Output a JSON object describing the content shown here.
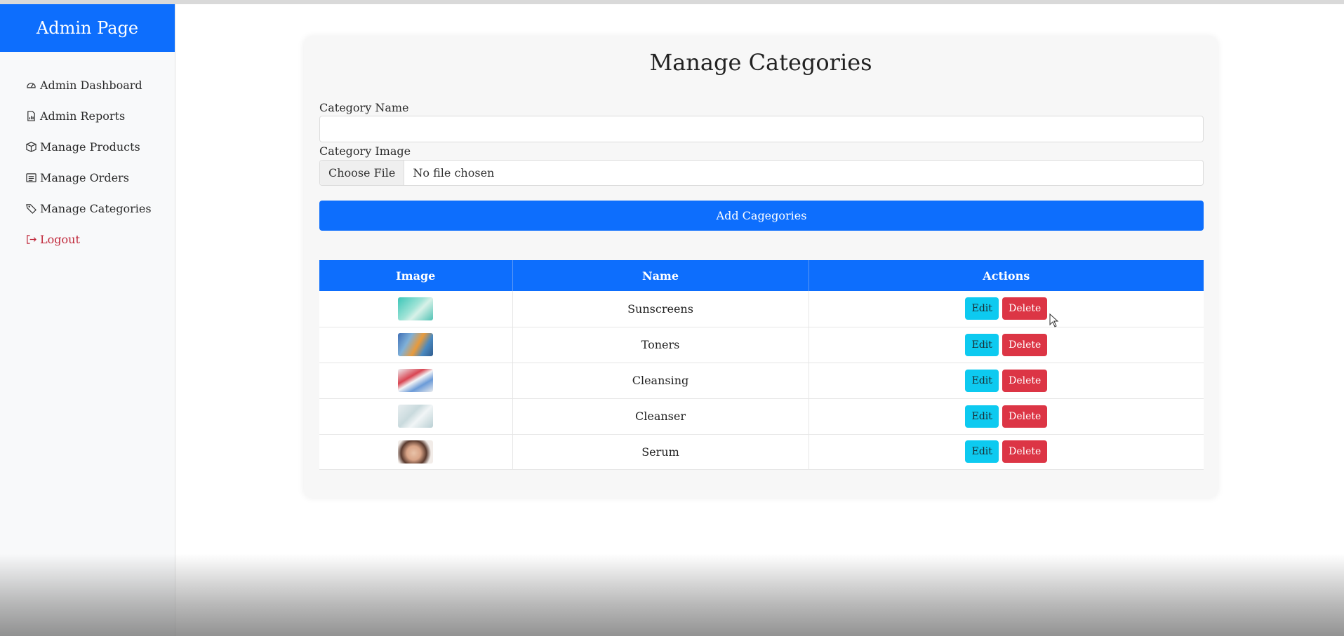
{
  "sidebar": {
    "brand": "Admin Page",
    "items": [
      {
        "label": "Admin Dashboard",
        "icon": "speedometer-icon"
      },
      {
        "label": "Admin Reports",
        "icon": "report-icon"
      },
      {
        "label": "Manage Products",
        "icon": "box-icon"
      },
      {
        "label": "Manage Orders",
        "icon": "list-icon"
      },
      {
        "label": "Manage Categories",
        "icon": "tag-icon"
      },
      {
        "label": "Logout",
        "icon": "logout-icon"
      }
    ]
  },
  "form": {
    "title": "Manage Categories",
    "name_label": "Category Name",
    "name_value": "",
    "image_label": "Category Image",
    "file_button": "Choose File",
    "file_status": "No file chosen",
    "submit_label": "Add Cagegories"
  },
  "table": {
    "headers": [
      "Image",
      "Name",
      "Actions"
    ],
    "edit_label": "Edit",
    "delete_label": "Delete",
    "rows": [
      {
        "name": "Sunscreens"
      },
      {
        "name": "Toners"
      },
      {
        "name": "Cleansing"
      },
      {
        "name": "Cleanser"
      },
      {
        "name": "Serum"
      }
    ]
  },
  "colors": {
    "primary": "#0d6efd",
    "info": "#0dcaf0",
    "danger": "#dc3545",
    "logout": "#c0283a"
  }
}
